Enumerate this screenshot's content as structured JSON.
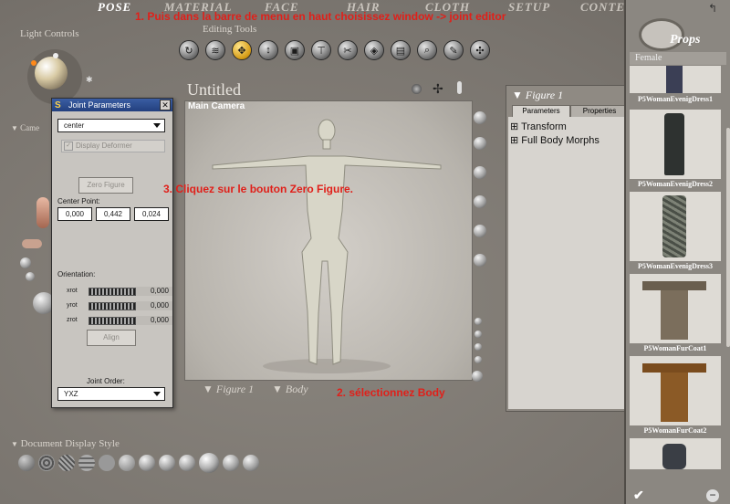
{
  "menu": {
    "tabs": [
      "POSE",
      "MATERIAL",
      "FACE",
      "HAIR",
      "CLOTH",
      "SETUP",
      "CONTE"
    ],
    "active": "POSE"
  },
  "annotations": {
    "step1": "1. Puis dans la barre de menu en haut choisissez window -> joint editor",
    "step2": "2. sélectionnez Body",
    "step3": "3. Cliquez sur le bouton Zero Figure."
  },
  "left": {
    "light_controls": "Light Controls",
    "camera_label": "Came",
    "document_display_style": "Document Display Style"
  },
  "editing_tools_label": "Editing Tools",
  "document": {
    "title": "Untitled",
    "camera": "Main Camera",
    "figure_selector": "Figure 1",
    "part_selector": "Body"
  },
  "joint_parameters": {
    "title": "Joint Parameters",
    "joint_dropdown": "center",
    "display_deformer": "Display Deformer",
    "zero_figure": "Zero Figure",
    "center_point_label": "Center Point:",
    "center_point": [
      "0,000",
      "0,442",
      "0,024"
    ],
    "orientation_label": "Orientation:",
    "rotations": [
      {
        "name": "xrot",
        "value": "0,000"
      },
      {
        "name": "yrot",
        "value": "0,000"
      },
      {
        "name": "zrot",
        "value": "0,000"
      }
    ],
    "align": "Align",
    "joint_order_label": "Joint Order:",
    "joint_order": "YXZ"
  },
  "figure_panel": {
    "title": "Figure 1",
    "tabs": [
      "Parameters",
      "Properties"
    ],
    "active_tab": "Parameters",
    "items": [
      "Transform",
      "Full Body Morphs"
    ]
  },
  "library": {
    "title": "Props",
    "category": "Female",
    "items": [
      "P5WomanEvenigDress1",
      "P5WomanEvenigDress2",
      "P5WomanEvenigDress3",
      "P5WomanFurCoat1",
      "P5WomanFurCoat2"
    ]
  },
  "colors": {
    "annotation": "#e0201a",
    "selected_tool": "#d49a14"
  }
}
